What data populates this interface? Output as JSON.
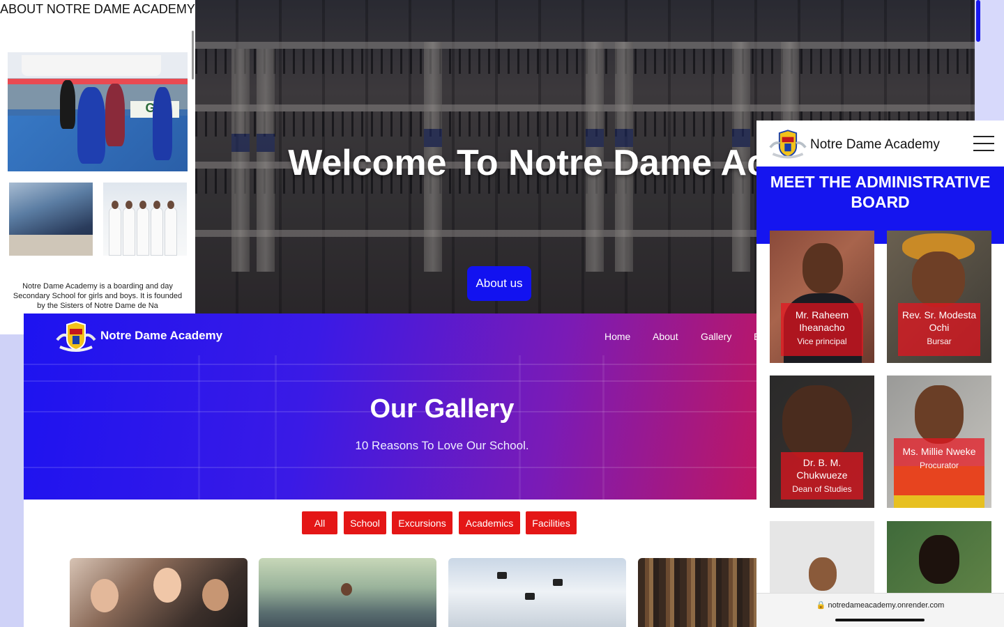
{
  "hero": {
    "title": "Welcome To Notre Dame Academy",
    "button": "About us"
  },
  "about": {
    "title": "ABOUT NOTRE DAME ACADEMY",
    "text": "Notre Dame Academy is a boarding and day Secondary School for girls and boys. It is founded by the Sisters of Notre Dame de Na",
    "photo_sign": "GA"
  },
  "gallery": {
    "brand": "Notre Dame Academy",
    "nav": [
      "Home",
      "About",
      "Gallery",
      "E"
    ],
    "title": "Our Gallery",
    "subtitle": "10 Reasons To Love Our School.",
    "filters": [
      "All",
      "School",
      "Excursions",
      "Academics",
      "Facilities"
    ]
  },
  "board": {
    "brand": "Notre Dame Academy",
    "title": "MEET THE ADMINISTRATIVE BOARD",
    "members": [
      {
        "name": "Mr. Raheem Iheanacho",
        "role": "Vice principal"
      },
      {
        "name": "Rev. Sr. Modesta Ochi",
        "role": "Bursar"
      },
      {
        "name": "Dr. B. M. Chukwueze",
        "role": "Dean of Studies"
      },
      {
        "name": "Ms. Millie Nweke",
        "role": "Procurator"
      }
    ],
    "url": "notredameacademy.onrender.com"
  },
  "colors": {
    "brand_blue": "#1515ef",
    "accent_red": "#e41616",
    "gallery_gradient": [
      "#1d13f0",
      "#c2165e"
    ]
  },
  "icons": [
    "crest-logo",
    "hamburger-menu-icon",
    "lock-icon"
  ]
}
